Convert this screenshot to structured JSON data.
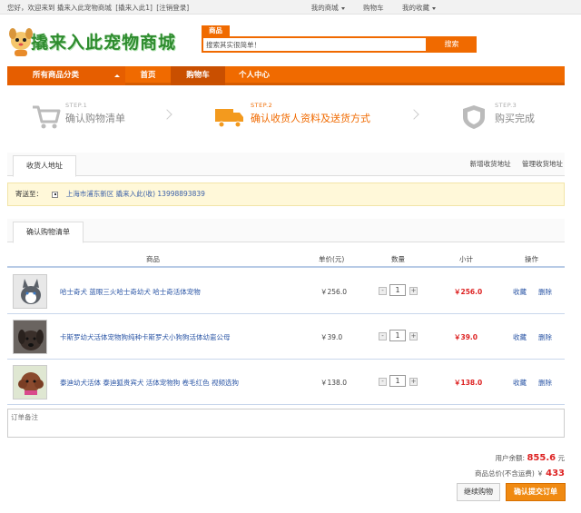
{
  "topbar": {
    "welcome": "您好，欢迎来到 撬来入此宠物商城",
    "user": "[撬来入此1]",
    "logout": "[注销登录]",
    "my_mall": "我的商城",
    "cart": "购物车",
    "favorites": "我的收藏"
  },
  "header": {
    "logo_text": "撬来入此宠物商城",
    "search_tab": "商品",
    "search_value": "搜索其实很简单！",
    "search_button": "搜索"
  },
  "nav": {
    "categories": "所有商品分类",
    "items": [
      "首页",
      "购物车",
      "个人中心"
    ],
    "active": "购物车"
  },
  "steps": [
    {
      "num": "STEP.1",
      "name": "确认购物清单",
      "active": false
    },
    {
      "num": "STEP.2",
      "name": "确认收货人资料及送货方式",
      "active": true
    },
    {
      "num": "STEP.3",
      "name": "购买完成",
      "active": false
    }
  ],
  "address_section": {
    "tab": "收货人地址",
    "add_link": "新增收货地址",
    "manage_link": "管理收货地址",
    "send_to_label": "寄送至：",
    "address": "上海市浦东新区  撬来入此(收)  13998893839"
  },
  "cart_section": {
    "tab": "确认购物清单",
    "headers": {
      "product": "商品",
      "price": "单价(元)",
      "qty": "数量",
      "subtotal": "小计",
      "ops": "操作"
    },
    "rows": [
      {
        "name": "哈士奇犬 蓝眼三火哈士奇幼犬 哈士奇活体宠物",
        "price": "￥256.0",
        "qty": "1",
        "subtotal": "￥256.0",
        "fav": "收藏",
        "del": "删除",
        "thumb_color": "#5a6068"
      },
      {
        "name": "卡斯罗幼犬活体宠物狗纯种卡斯罗犬小狗狗活体幼崽公母",
        "price": "￥39.0",
        "qty": "1",
        "subtotal": "￥39.0",
        "fav": "收藏",
        "del": "删除",
        "thumb_color": "#3a2f2a"
      },
      {
        "name": "泰迪幼犬活体 泰迪狐贵宾犬 活体宠物狗 卷毛红色 视频选狗",
        "price": "￥138.0",
        "qty": "1",
        "subtotal": "￥138.0",
        "fav": "收藏",
        "del": "删除",
        "thumb_color": "#8a4a2e"
      }
    ]
  },
  "memo": {
    "placeholder": "订单备注"
  },
  "summary": {
    "balance_label": "用户余额:",
    "balance": "855.6",
    "balance_unit": "元",
    "total_label": "商品总价(不含运费)",
    "total_prefix": "￥",
    "total": "433"
  },
  "buttons": {
    "continue": "继续购物",
    "submit": "确认提交订单"
  },
  "colors": {
    "accent": "#f06a00",
    "price_red": "#dd2222",
    "link_blue": "#2a55a5"
  }
}
